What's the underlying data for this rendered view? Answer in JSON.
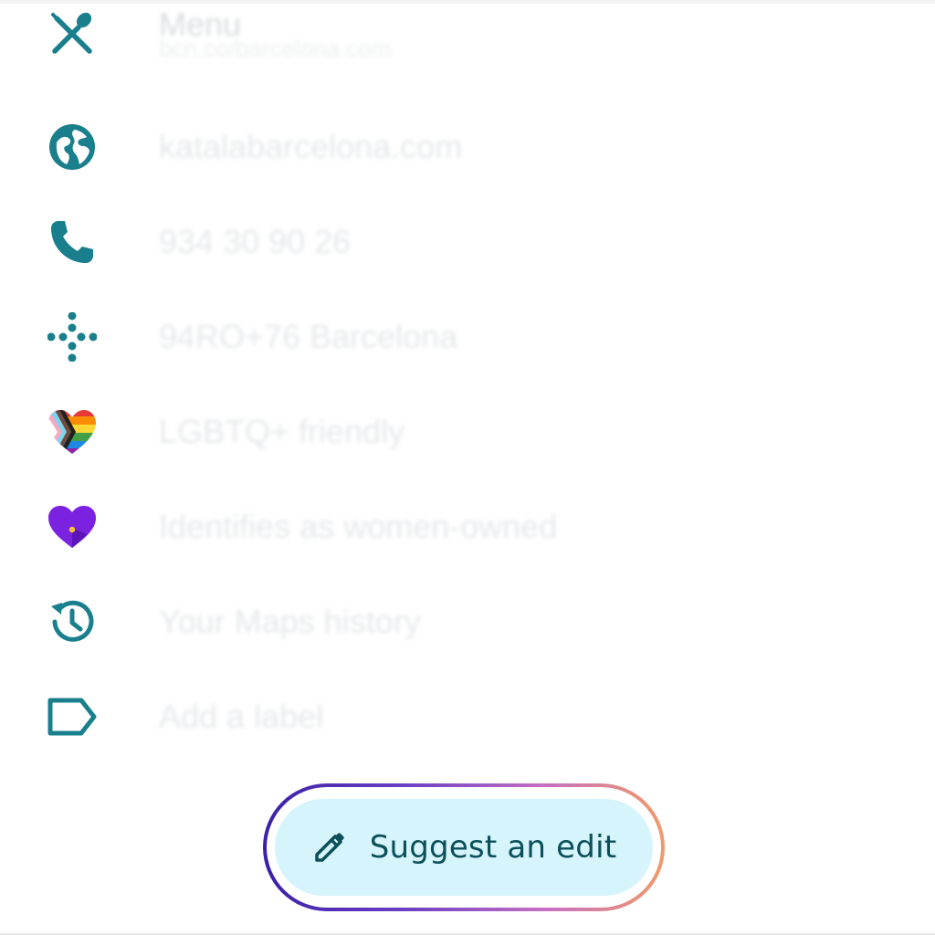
{
  "rows": [
    {
      "icon": "restaurant-icon",
      "label": "Menu",
      "sublabel": "bcn.co/barcelona.com"
    },
    {
      "icon": "globe-icon",
      "label": "katalabarcelona.com"
    },
    {
      "icon": "phone-icon",
      "label": "934 30 90 26"
    },
    {
      "icon": "plus-code-icon",
      "label": "94RO+76 Barcelona"
    },
    {
      "icon": "lgbtq-heart-icon",
      "label": "LGBTQ+ friendly"
    },
    {
      "icon": "women-owned-heart-icon",
      "label": "Identifies as women-owned"
    },
    {
      "icon": "history-icon",
      "label": "Your Maps history"
    },
    {
      "icon": "label-icon",
      "label": "Add a label"
    }
  ],
  "suggest_edit": {
    "label": "Suggest an edit",
    "icon": "pencil-icon"
  },
  "colors": {
    "icon_teal": "#1a7f8c",
    "button_bg": "#d6f4fb",
    "button_text": "#0b4f5a",
    "gradient_start": "#3b1fa8",
    "gradient_end": "#f09a6a",
    "heart_purple": "#7b22e0"
  }
}
